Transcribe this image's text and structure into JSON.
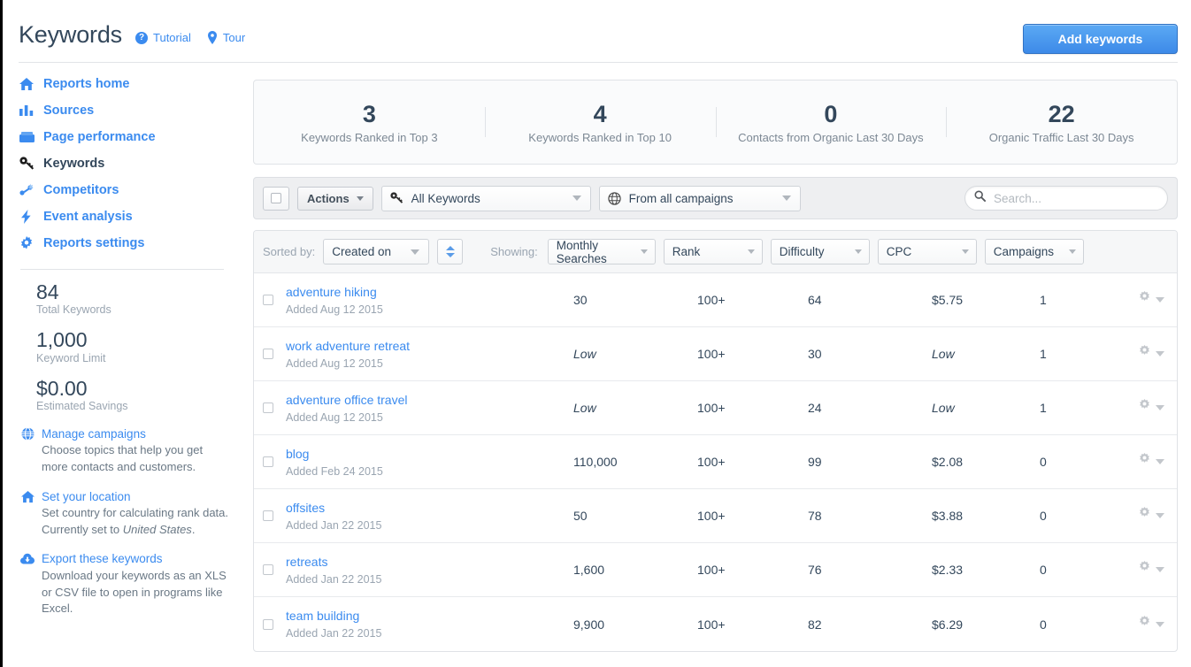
{
  "header": {
    "title": "Keywords",
    "links": [
      {
        "label": "Tutorial",
        "icon": "help-circle-icon"
      },
      {
        "label": "Tour",
        "icon": "map-pin-icon"
      }
    ],
    "add_button": "Add keywords"
  },
  "sidebar": {
    "nav": [
      {
        "label": "Reports home",
        "icon": "home-icon",
        "active": false
      },
      {
        "label": "Sources",
        "icon": "bar-chart-icon",
        "active": false
      },
      {
        "label": "Page performance",
        "icon": "inbox-icon",
        "active": false
      },
      {
        "label": "Keywords",
        "icon": "key-icon",
        "active": true
      },
      {
        "label": "Competitors",
        "icon": "competitors-icon",
        "active": false
      },
      {
        "label": "Event analysis",
        "icon": "lightning-icon",
        "active": false
      },
      {
        "label": "Reports settings",
        "icon": "gear-icon",
        "active": false
      }
    ],
    "stats": [
      {
        "value": "84",
        "label": "Total Keywords"
      },
      {
        "value": "1,000",
        "label": "Keyword Limit"
      },
      {
        "value": "$0.00",
        "label": "Estimated Savings"
      }
    ],
    "helpers": [
      {
        "icon": "globe-icon",
        "title": "Manage campaigns",
        "desc": "Choose topics that help you get more contacts and customers."
      },
      {
        "icon": "home-icon",
        "title": "Set your location",
        "desc_pre": "Set country for calculating rank data. Currently set to ",
        "desc_em": "United States",
        "desc_post": "."
      },
      {
        "icon": "export-cloud-icon",
        "title": "Export these keywords",
        "desc": "Download your keywords as an XLS or CSV file to open in programs like Excel."
      }
    ]
  },
  "stats_bar": [
    {
      "value": "3",
      "label": "Keywords Ranked in Top 3"
    },
    {
      "value": "4",
      "label": "Keywords Ranked in Top 10"
    },
    {
      "value": "0",
      "label": "Contacts from Organic Last 30 Days"
    },
    {
      "value": "22",
      "label": "Organic Traffic Last 30 Days"
    }
  ],
  "toolbar": {
    "actions_label": "Actions",
    "keyword_filter": "All Keywords",
    "keyword_filter_icon": "key-icon",
    "campaign_filter": "From all campaigns",
    "campaign_filter_icon": "globe-icon",
    "search_placeholder": "Search...",
    "search_value": "",
    "search_icon": "search-icon"
  },
  "sortbar": {
    "sorted_by_label": "Sorted by:",
    "sorted_by_value": "Created on",
    "sort_direction_icon": "sort-updown-icon",
    "showing_label": "Showing:",
    "columns": [
      "Monthly Searches",
      "Rank",
      "Difficulty",
      "CPC",
      "Campaigns"
    ]
  },
  "table": {
    "rows": [
      {
        "keyword": "adventure hiking",
        "added": "Added Aug 12 2015",
        "monthly_searches": "30",
        "ms_low": false,
        "rank": "100+",
        "difficulty": "64",
        "cpc": "$5.75",
        "cpc_low": false,
        "campaigns": "1"
      },
      {
        "keyword": "work adventure retreat",
        "added": "Added Aug 12 2015",
        "monthly_searches": "Low",
        "ms_low": true,
        "rank": "100+",
        "difficulty": "30",
        "cpc": "Low",
        "cpc_low": true,
        "campaigns": "1"
      },
      {
        "keyword": "adventure office travel",
        "added": "Added Aug 12 2015",
        "monthly_searches": "Low",
        "ms_low": true,
        "rank": "100+",
        "difficulty": "24",
        "cpc": "Low",
        "cpc_low": true,
        "campaigns": "1"
      },
      {
        "keyword": "blog",
        "added": "Added Feb 24 2015",
        "monthly_searches": "110,000",
        "ms_low": false,
        "rank": "100+",
        "difficulty": "99",
        "cpc": "$2.08",
        "cpc_low": false,
        "campaigns": "0"
      },
      {
        "keyword": "offsites",
        "added": "Added Jan 22 2015",
        "monthly_searches": "50",
        "ms_low": false,
        "rank": "100+",
        "difficulty": "78",
        "cpc": "$3.88",
        "cpc_low": false,
        "campaigns": "0"
      },
      {
        "keyword": "retreats",
        "added": "Added Jan 22 2015",
        "monthly_searches": "1,600",
        "ms_low": false,
        "rank": "100+",
        "difficulty": "76",
        "cpc": "$2.33",
        "cpc_low": false,
        "campaigns": "0"
      },
      {
        "keyword": "team building",
        "added": "Added Jan 22 2015",
        "monthly_searches": "9,900",
        "ms_low": false,
        "rank": "100+",
        "difficulty": "82",
        "cpc": "$6.29",
        "cpc_low": false,
        "campaigns": "0"
      }
    ]
  },
  "colors": {
    "link_blue": "#3b8bef",
    "text_dark": "#33475b",
    "muted": "#9aa5b1",
    "button_blue": "#3d8ae8"
  }
}
